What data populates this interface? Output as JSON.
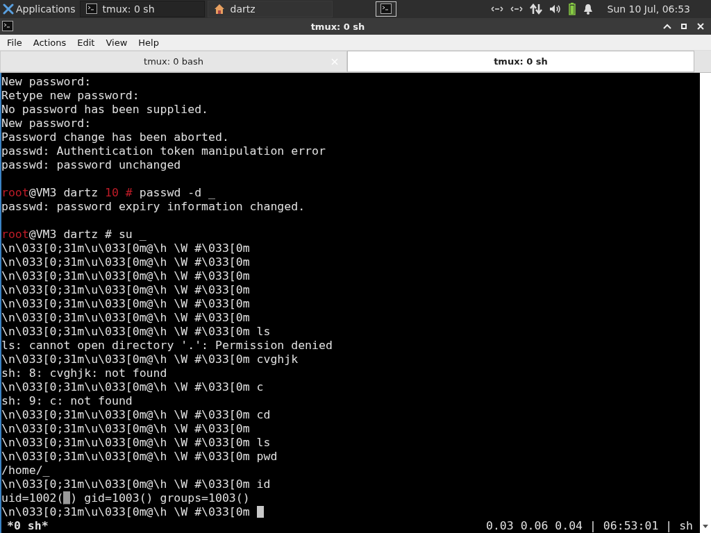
{
  "panel": {
    "apps_label": "Applications",
    "tasks": [
      {
        "label": "tmux: 0 sh",
        "kind": "terminal",
        "selected": true
      },
      {
        "label": "dartz",
        "kind": "home",
        "selected": false
      }
    ],
    "clock": "Sun 10 Jul, 06:53"
  },
  "window": {
    "title": "tmux: 0 sh"
  },
  "menu": [
    "File",
    "Actions",
    "Edit",
    "View",
    "Help"
  ],
  "tabs": [
    {
      "label": "tmux: 0 bash",
      "selected": false
    },
    {
      "label": "tmux: 0 sh",
      "selected": true
    }
  ],
  "terminal": {
    "blocks": [
      {
        "lines": [
          {
            "segments": [
              {
                "text": "New password:"
              }
            ]
          },
          {
            "segments": [
              {
                "text": "Retype new password:"
              }
            ]
          },
          {
            "segments": [
              {
                "text": "No password has been supplied."
              }
            ]
          },
          {
            "segments": [
              {
                "text": "New password:"
              }
            ]
          },
          {
            "segments": [
              {
                "text": "Password change has been aborted."
              }
            ]
          },
          {
            "segments": [
              {
                "text": "passwd: Authentication token manipulation error"
              }
            ]
          },
          {
            "segments": [
              {
                "text": "passwd: password unchanged"
              }
            ]
          }
        ]
      },
      {
        "lines": [
          {
            "segments": [
              {
                "text": "root",
                "color": "#c01c28"
              },
              {
                "text": "@VM3 dartz "
              },
              {
                "text": "10 #",
                "color": "#c01c28"
              },
              {
                "text": " passwd -d _"
              }
            ]
          },
          {
            "segments": [
              {
                "text": "passwd: password expiry information changed."
              }
            ]
          }
        ]
      },
      {
        "lines": [
          {
            "segments": [
              {
                "text": "root",
                "color": "#c01c28"
              },
              {
                "text": "@VM3 dartz # su _"
              }
            ]
          },
          {
            "segments": [
              {
                "text": "\\n\\033[0;31m\\u\\033[0m@\\h \\W #\\033[0m"
              }
            ]
          },
          {
            "segments": [
              {
                "text": "\\n\\033[0;31m\\u\\033[0m@\\h \\W #\\033[0m"
              }
            ]
          },
          {
            "segments": [
              {
                "text": "\\n\\033[0;31m\\u\\033[0m@\\h \\W #\\033[0m"
              }
            ]
          },
          {
            "segments": [
              {
                "text": "\\n\\033[0;31m\\u\\033[0m@\\h \\W #\\033[0m"
              }
            ]
          },
          {
            "segments": [
              {
                "text": "\\n\\033[0;31m\\u\\033[0m@\\h \\W #\\033[0m"
              }
            ]
          },
          {
            "segments": [
              {
                "text": "\\n\\033[0;31m\\u\\033[0m@\\h \\W #\\033[0m"
              }
            ]
          },
          {
            "segments": [
              {
                "text": "\\n\\033[0;31m\\u\\033[0m@\\h \\W #\\033[0m ls"
              }
            ]
          },
          {
            "segments": [
              {
                "text": "ls: cannot open directory '.': Permission denied"
              }
            ]
          },
          {
            "segments": [
              {
                "text": "\\n\\033[0;31m\\u\\033[0m@\\h \\W #\\033[0m cvghjk"
              }
            ]
          },
          {
            "segments": [
              {
                "text": "sh: 8: cvghjk: not found"
              }
            ]
          },
          {
            "segments": [
              {
                "text": "\\n\\033[0;31m\\u\\033[0m@\\h \\W #\\033[0m c"
              }
            ]
          },
          {
            "segments": [
              {
                "text": "sh: 9: c: not found"
              }
            ]
          },
          {
            "segments": [
              {
                "text": "\\n\\033[0;31m\\u\\033[0m@\\h \\W #\\033[0m cd"
              }
            ]
          },
          {
            "segments": [
              {
                "text": "\\n\\033[0;31m\\u\\033[0m@\\h \\W #\\033[0m"
              }
            ]
          },
          {
            "segments": [
              {
                "text": "\\n\\033[0;31m\\u\\033[0m@\\h \\W #\\033[0m ls"
              }
            ]
          },
          {
            "segments": [
              {
                "text": "\\n\\033[0;31m\\u\\033[0m@\\h \\W #\\033[0m pwd"
              }
            ]
          },
          {
            "segments": [
              {
                "text": "/home/_"
              }
            ]
          },
          {
            "segments": [
              {
                "text": "\\n\\033[0;31m\\u\\033[0m@\\h \\W #\\033[0m id"
              }
            ]
          },
          {
            "segments": [
              {
                "text": "uid=1002("
              },
              {
                "text": "_",
                "highlight": true
              },
              {
                "text": ") gid=1003() groups=1003()"
              }
            ]
          },
          {
            "segments": [
              {
                "text": "\\n\\033[0;31m\\u\\033[0m@\\h \\W #\\033[0m "
              }
            ],
            "cursor": true
          }
        ]
      }
    ],
    "status_left": "*0 sh*",
    "status_right": "0.03 0.06 0.04 | 06:53:01 | sh"
  }
}
